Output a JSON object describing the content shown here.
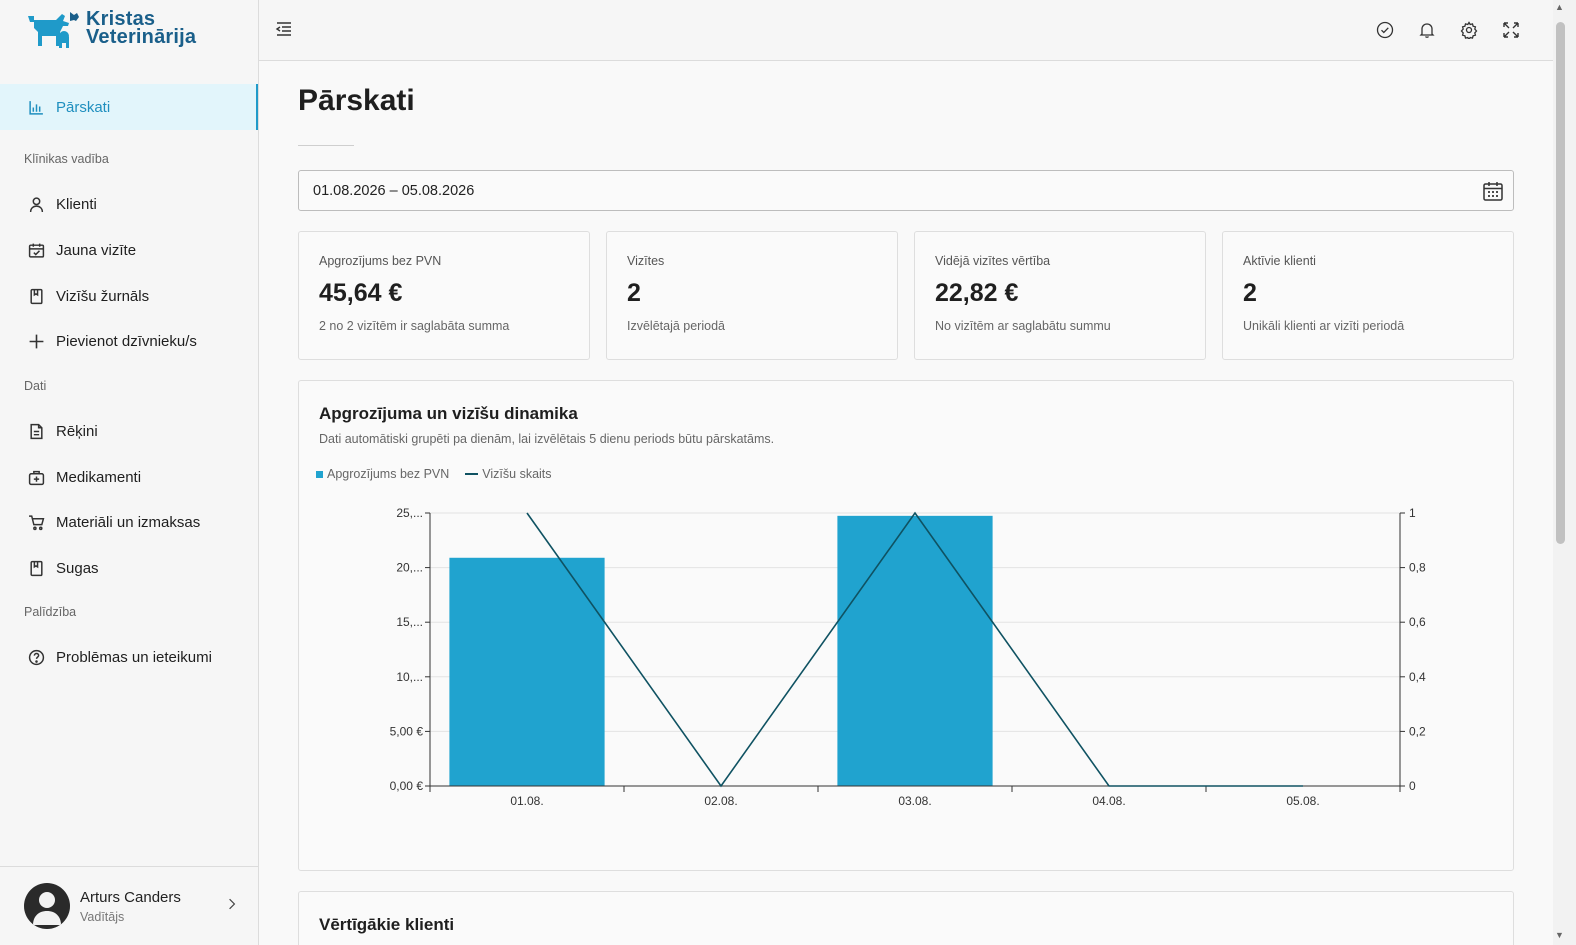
{
  "app": {
    "brand_line1": "Kristas",
    "brand_line2": "Veterinārija",
    "brand_color": "#1a5f8a",
    "accent_color": "#1f9ac9"
  },
  "sidebar": {
    "active": {
      "label": "Pārskati",
      "icon": "bar-chart-icon"
    },
    "sections": [
      {
        "label": "Klīnikas vadība",
        "items": [
          {
            "label": "Klienti",
            "icon": "user-icon"
          },
          {
            "label": "Jauna vizīte",
            "icon": "calendar-check-icon"
          },
          {
            "label": "Vizīšu žurnāls",
            "icon": "book-icon"
          },
          {
            "label": "Pievienot dzīvnieku/s",
            "icon": "plus-icon"
          }
        ]
      },
      {
        "label": "Dati",
        "items": [
          {
            "label": "Rēķini",
            "icon": "document-icon"
          },
          {
            "label": "Medikamenti",
            "icon": "medkit-icon"
          },
          {
            "label": "Materiāli un izmaksas",
            "icon": "cart-icon"
          },
          {
            "label": "Sugas",
            "icon": "book-icon"
          }
        ]
      },
      {
        "label": "Palīdzība",
        "items": [
          {
            "label": "Problēmas un ieteikumi",
            "icon": "help-circle-icon"
          }
        ]
      }
    ],
    "user": {
      "name": "Arturs Canders",
      "role": "Vadītājs"
    }
  },
  "header": {
    "icons": [
      "menu-collapse-icon",
      "check-circle-icon",
      "bell-icon",
      "gear-icon",
      "fullscreen-icon"
    ]
  },
  "main": {
    "title": "Pārskati",
    "date_range": "01.08.2026 – 05.08.2026",
    "kpis": [
      {
        "label": "Apgrozījums bez PVN",
        "value": "45,64 €",
        "sub": "2 no 2 vizītēm ir saglabāta summa"
      },
      {
        "label": "Vizītes",
        "value": "2",
        "sub": "Izvēlētajā periodā"
      },
      {
        "label": "Vidējā vizītes vērtība",
        "value": "22,82 €",
        "sub": "No vizītēm ar saglabātu summu"
      },
      {
        "label": "Aktīvie klienti",
        "value": "2",
        "sub": "Unikāli klienti ar vizīti periodā"
      }
    ],
    "chart_card": {
      "title": "Apgrozījuma un vizīšu dinamika",
      "subtitle": "Dati automātiski grupēti pa dienām, lai izvēlētais 5 dienu periods būtu pārskatāms."
    },
    "next_card": {
      "title": "Vērtīgākie klienti"
    }
  },
  "chart_data": {
    "type": "bar",
    "categories": [
      "01.08.",
      "02.08.",
      "03.08.",
      "04.08.",
      "05.08."
    ],
    "series": [
      {
        "name": "Apgrozījums bez PVN",
        "type": "bar",
        "axis": "left",
        "color": "#20a3cf",
        "values": [
          20.9,
          0,
          24.74,
          0,
          0
        ]
      },
      {
        "name": "Vizīšu skaits",
        "type": "line",
        "axis": "right",
        "color": "#0f5262",
        "values": [
          1,
          0,
          1,
          0,
          0
        ]
      }
    ],
    "y_left": {
      "ylim": [
        0,
        25
      ],
      "ticks": [
        0,
        5,
        10,
        15,
        20,
        25
      ],
      "tick_labels": [
        "0,00 €",
        "5,00 €",
        "10,...",
        "15,...",
        "20,...",
        "25,..."
      ]
    },
    "y_right": {
      "ylim": [
        0,
        1
      ],
      "ticks": [
        0,
        0.2,
        0.4,
        0.6,
        0.8,
        1
      ],
      "tick_labels": [
        "0",
        "0,2",
        "0,4",
        "0,6",
        "0,8",
        "1"
      ]
    },
    "grid": true,
    "legend": "top-left"
  }
}
